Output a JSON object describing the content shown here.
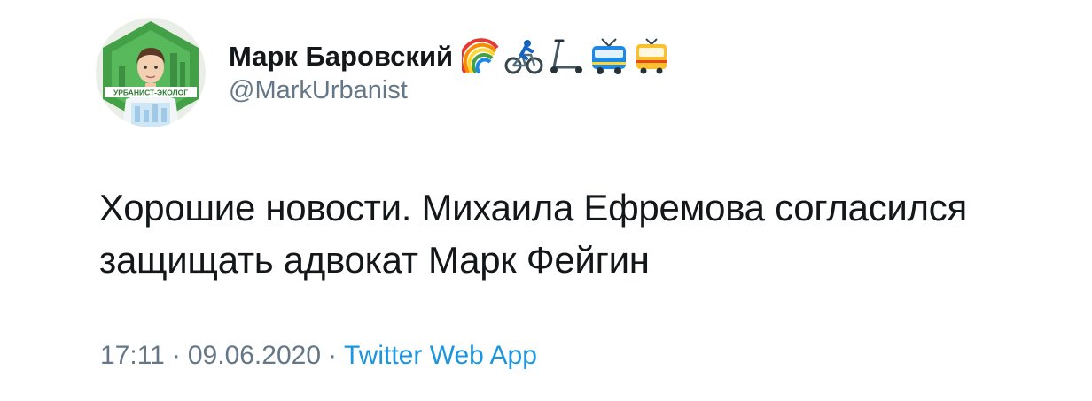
{
  "user": {
    "display_name": "Марк Баровский",
    "handle": "@MarkUrbanist",
    "avatar_caption": "УРБАНИСТ-ЭКОЛОГ",
    "name_emojis": [
      "rainbow-icon",
      "cyclist-icon",
      "kick-scooter-icon",
      "trolleybus-icon",
      "tram-icon"
    ]
  },
  "tweet": {
    "text": "Хорошие новости. Михаила Ефремова согласился защищать адвокат Марк Фейгин",
    "time": "17:11",
    "date": "09.06.2020",
    "separator": "·",
    "source": "Twitter Web App"
  },
  "colors": {
    "text": "#14171a",
    "secondary": "#657786",
    "link": "#1b95e0",
    "avatar_bg": "#4caf50"
  }
}
